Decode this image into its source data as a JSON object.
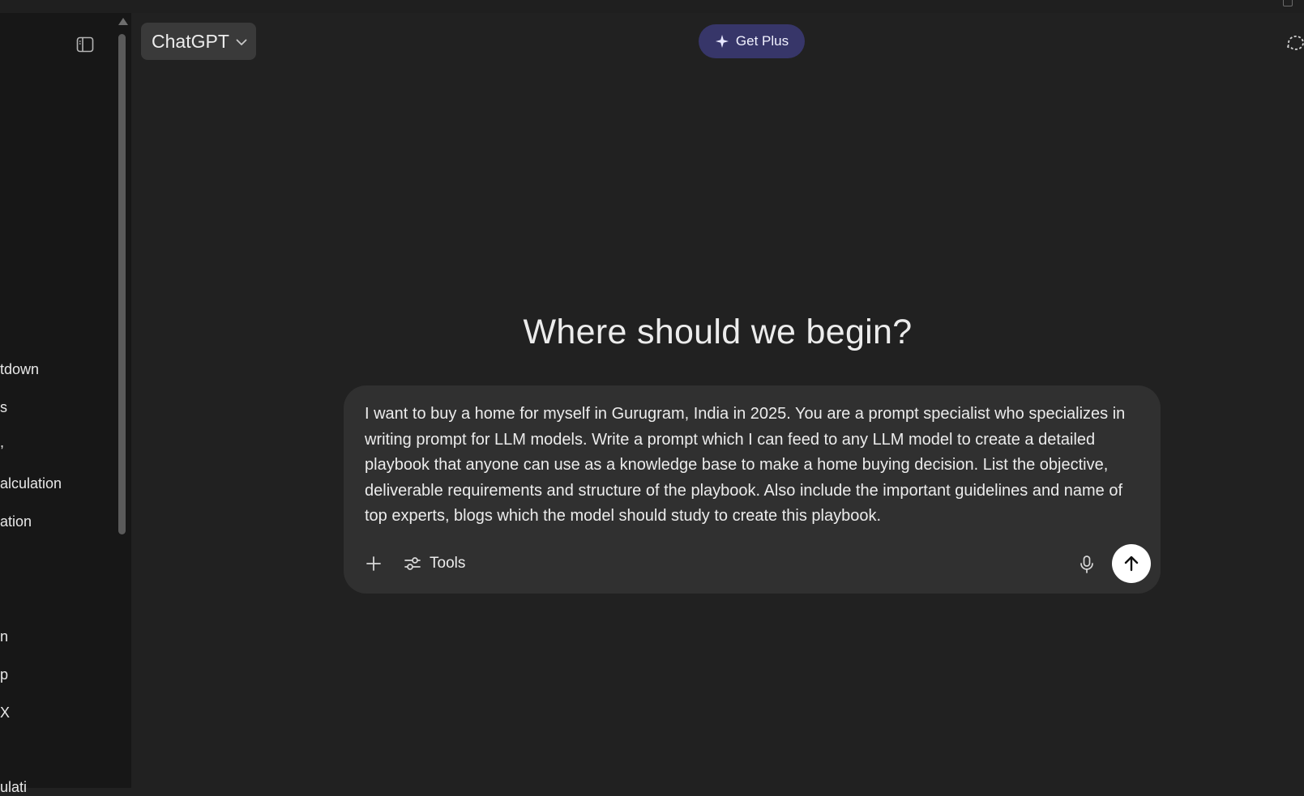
{
  "header": {
    "model_label": "ChatGPT",
    "get_plus_label": "Get Plus"
  },
  "sidebar": {
    "chats": [
      {
        "label": "tdown"
      },
      {
        "label": "s"
      },
      {
        "label": ","
      },
      {
        "label": "alculation"
      },
      {
        "label": "ation"
      },
      {
        "label": "n"
      },
      {
        "label": "p"
      },
      {
        "label": "X"
      },
      {
        "label": "ulati"
      }
    ]
  },
  "main": {
    "headline": "Where should we begin?",
    "composer": {
      "text": "I want to buy a home for myself in Gurugram, India in 2025. You are a prompt specialist who specializes in writing prompt for LLM models. Write a prompt which I can feed to any LLM model to create a detailed playbook that anyone can use as a knowledge base to make a home buying decision. List the objective, deliverable requirements and structure of the playbook. Also include the important guidelines and name of top experts, blogs which the model should study to create this playbook.",
      "tools_label": "Tools"
    }
  },
  "colors": {
    "background": "#212121",
    "sidebar": "#171717",
    "composer": "#303030",
    "get_plus_bg": "#373669",
    "send_button": "#ffffff"
  },
  "icons": [
    "sidebar-toggle-icon",
    "chevron-down-icon",
    "sparkle-icon",
    "temporary-chat-icon",
    "plus-icon",
    "sliders-icon",
    "microphone-icon",
    "arrow-up-icon"
  ]
}
